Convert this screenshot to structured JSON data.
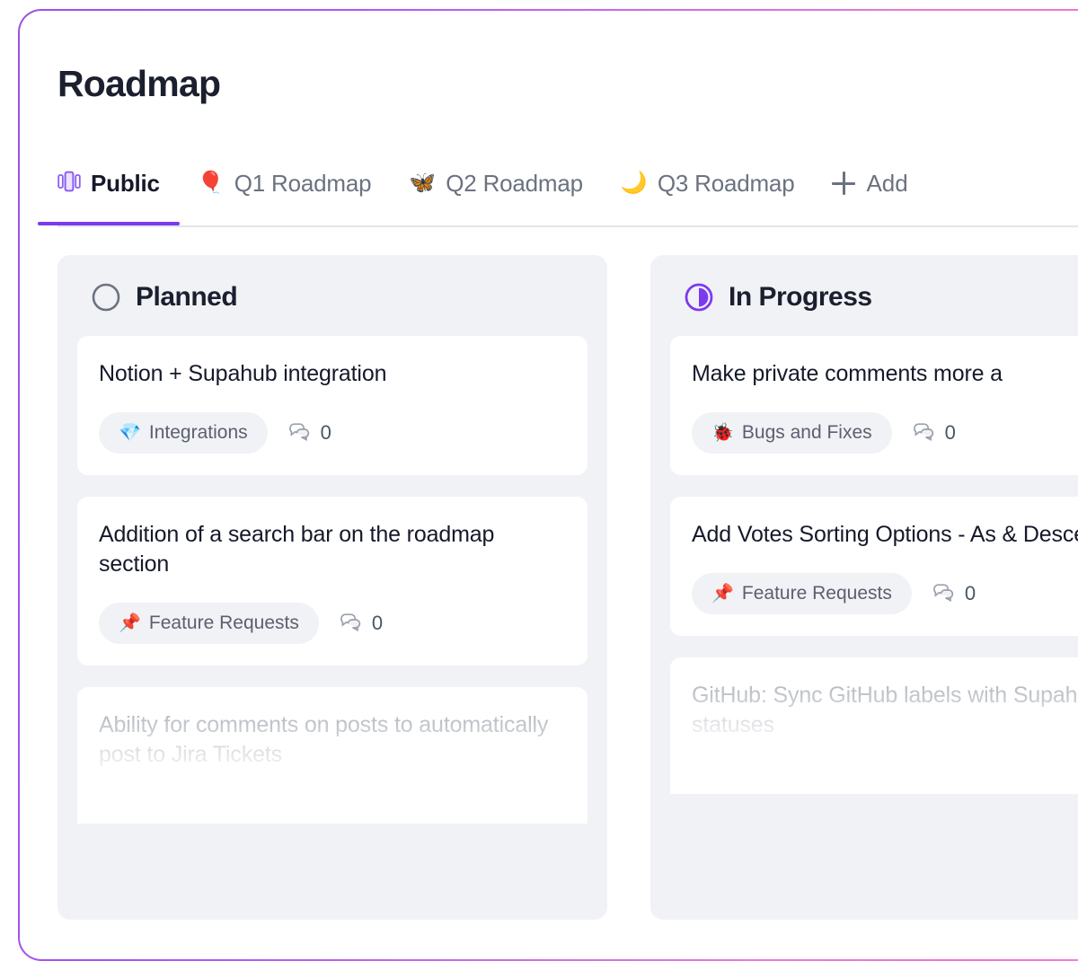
{
  "window": {
    "border_gradient_from": "#9b51e0",
    "border_gradient_to": "#f77fd6"
  },
  "header": {
    "title": "Roadmap"
  },
  "tabs": {
    "active_index": 0,
    "accent_color": "#7c3aed",
    "items": [
      {
        "label": "Public",
        "icon": "kanban-board-icon",
        "emoji": ""
      },
      {
        "label": "Q1 Roadmap",
        "icon": "balloon-icon",
        "emoji": "🎈"
      },
      {
        "label": "Q2 Roadmap",
        "icon": "butterfly-icon",
        "emoji": "🦋"
      },
      {
        "label": "Q3 Roadmap",
        "icon": "crescent-moon-icon",
        "emoji": "🌙"
      }
    ],
    "add": {
      "label": "Add",
      "icon": "plus-icon"
    }
  },
  "board": {
    "columns": [
      {
        "title": "Planned",
        "status_icon": "empty-circle-icon",
        "status_color": "#6b7280",
        "cards": [
          {
            "title": "Notion + Supahub integration",
            "tag": {
              "emoji": "💎",
              "label": "Integrations"
            },
            "comments": "0",
            "faded": false
          },
          {
            "title": "Addition of a search bar on the roadmap section",
            "tag": {
              "emoji": "📌",
              "label": "Feature Requests"
            },
            "comments": "0",
            "faded": false
          },
          {
            "title": "Ability for comments on posts to automatically post to Jira Tickets",
            "tag": {
              "emoji": "",
              "label": ""
            },
            "comments": "",
            "faded": true
          }
        ]
      },
      {
        "title": "In Progress",
        "status_icon": "half-filled-circle-icon",
        "status_color": "#7c3aed",
        "cards": [
          {
            "title": "Make private comments more a",
            "tag": {
              "emoji": "🐞",
              "label": "Bugs and Fixes"
            },
            "comments": "0",
            "faded": false
          },
          {
            "title": "Add Votes Sorting Options - As & Descending",
            "tag": {
              "emoji": "📌",
              "label": "Feature Requests"
            },
            "comments": "0",
            "faded": false
          },
          {
            "title": "GitHub: Sync GitHub labels with Supahub statuses",
            "tag": {
              "emoji": "",
              "label": ""
            },
            "comments": "",
            "faded": true
          }
        ]
      }
    ]
  }
}
